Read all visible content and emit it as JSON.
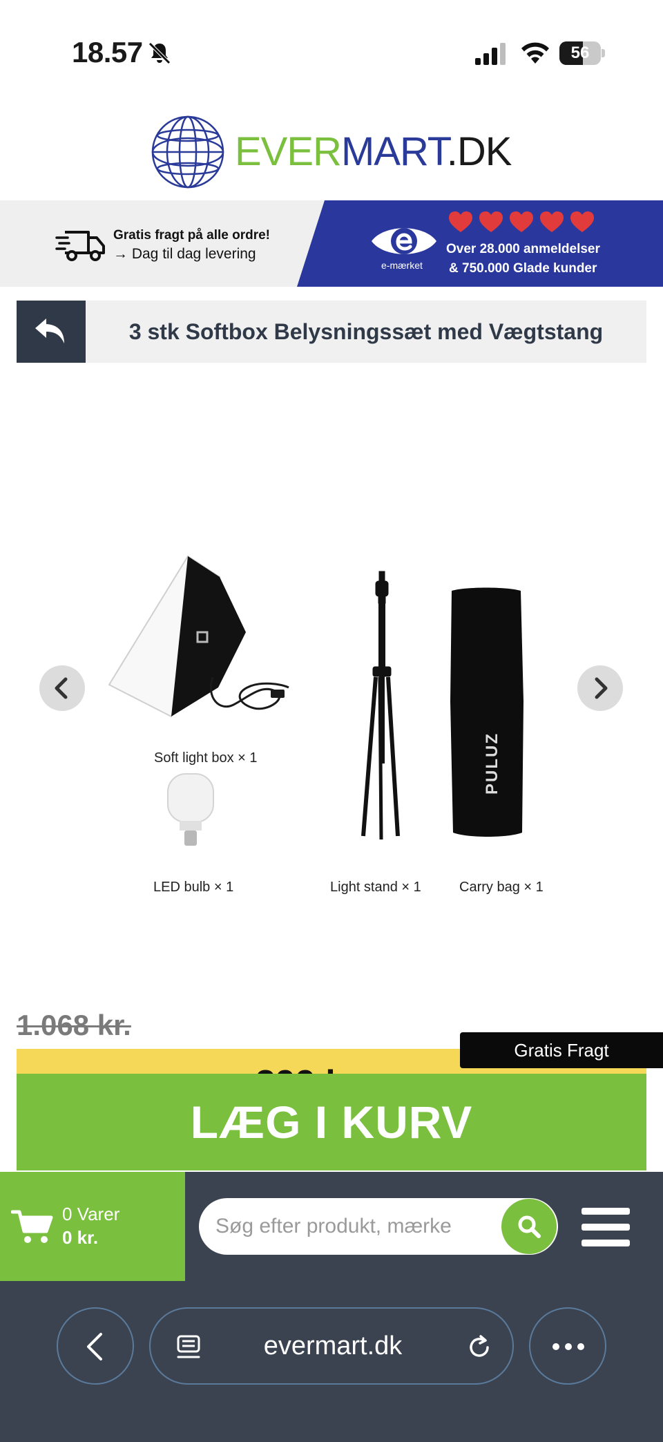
{
  "status_bar": {
    "time": "18.57",
    "battery_level": "56",
    "battery_percent": 56
  },
  "logo": {
    "part_ever": "EVER",
    "part_mart": "MART",
    "part_dk": ".DK"
  },
  "banner": {
    "shipping_title": "Gratis fragt på alle ordre!",
    "shipping_subtitle": "→ Dag til dag levering",
    "emark_label": "e-mærket",
    "hearts_count": 5,
    "reviews_line1": "Over 28.000 anmeldelser",
    "reviews_line2": "& 750.000 Glade kunder"
  },
  "product": {
    "title": "3 stk Softbox Belysningssæt med Vægtstang",
    "captions": {
      "softbox": "Soft light box × 1",
      "led": "LED bulb × 1",
      "stand": "Light stand × 1",
      "bag": "Carry bag × 1"
    },
    "old_price": "1.068 kr.",
    "current_price": "399 kr.",
    "free_shipping_label": "Gratis Fragt",
    "add_to_cart_label": "LÆG I KURV"
  },
  "nav": {
    "cart_count": "0 Varer",
    "cart_total": "0 kr.",
    "search_placeholder": "Søg efter produkt, mærke"
  },
  "browser": {
    "url": "evermart.dk"
  },
  "colors": {
    "brand_green": "#7bbf3e",
    "brand_blue": "#2a389d",
    "dark_slate": "#3b4350",
    "price_yellow": "#f5d857"
  }
}
